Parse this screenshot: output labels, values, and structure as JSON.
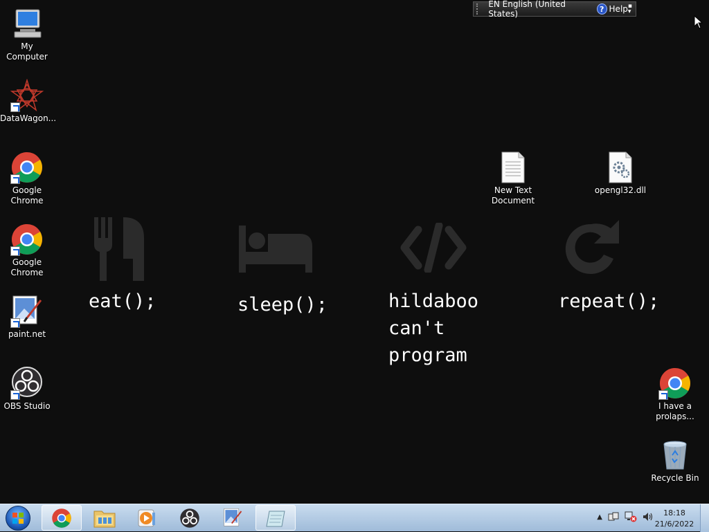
{
  "language_bar": {
    "language": "EN English (United States)",
    "help_label": "Help"
  },
  "desktop_icons": {
    "my_computer": "My Computer",
    "datawagon": "DataWagon...",
    "chrome1": "Google Chrome",
    "chrome2": "Google Chrome",
    "paintnet": "paint.net",
    "obs": "OBS Studio",
    "new_text": "New Text Document",
    "opengl": "opengl32.dll",
    "chrome3": "I have a prolaps...",
    "recycle": "Recycle Bin"
  },
  "wallpaper": {
    "eat": "eat();",
    "sleep": "sleep();",
    "code": "hildaboo\ncan't\nprogram",
    "repeat": "repeat();"
  },
  "taskbar": {
    "time": "18:18",
    "date": "21/6/2022"
  }
}
